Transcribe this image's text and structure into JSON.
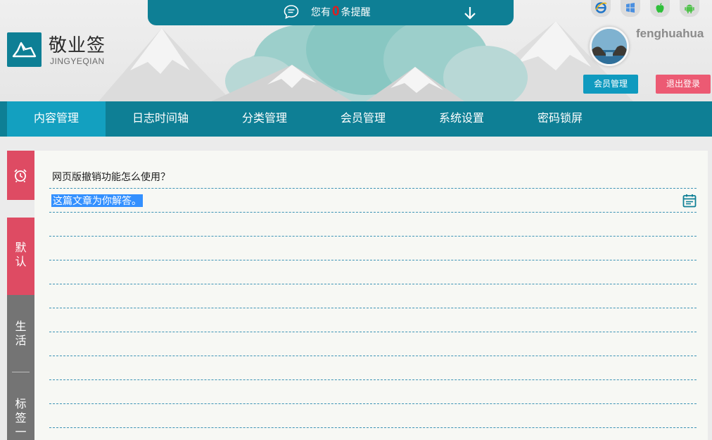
{
  "notify": {
    "prefix": "您有",
    "count": "0",
    "suffix": "条提醒"
  },
  "logo": {
    "title": "敬业签",
    "subtitle": "JINGYEQIAN"
  },
  "platforms": [
    "ie-icon",
    "windows-icon",
    "apple-icon",
    "android-icon"
  ],
  "user": {
    "name": "fenghuahua",
    "member_btn": "会员管理",
    "logout_btn": "退出登录"
  },
  "nav": [
    "内容管理",
    "日志时间轴",
    "分类管理",
    "会员管理",
    "系统设置",
    "密码锁屏"
  ],
  "left_tabs": {
    "default": [
      "默",
      "认"
    ],
    "life": [
      "生",
      "活"
    ],
    "tag": [
      "标",
      "签",
      "一"
    ]
  },
  "note": {
    "title": "网页版撤销功能怎么使用？",
    "selected_text": "这篇文章为你解答。"
  },
  "colors": {
    "teal": "#0e7f95",
    "nav_active": "#13a0c0",
    "pink": "#de4b63",
    "gray_tab": "#747474",
    "count_red": "#e11d1d"
  }
}
